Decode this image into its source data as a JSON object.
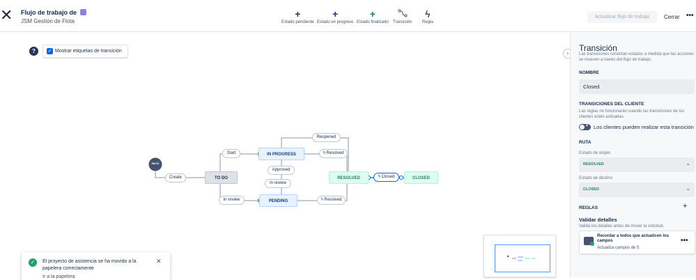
{
  "header": {
    "title": "Flujo de trabajo de",
    "project": "JSM Gestión de Flota",
    "toolbar": [
      {
        "label": "Estado pendiente",
        "icon": "plus-icon"
      },
      {
        "label": "Estado en progreso",
        "icon": "plus-icon"
      },
      {
        "label": "Estado finalizado",
        "icon": "plus-icon"
      },
      {
        "label": "Transición",
        "icon": "transition-icon"
      },
      {
        "label": "Regla",
        "icon": "bolt-icon"
      }
    ],
    "update_button": "Actualizar flujo de trabajo",
    "close_button": "Cerrar"
  },
  "canvas": {
    "show_labels": "Mostrar etiquetas de transición",
    "show_labels_checked": true,
    "nodes": {
      "start": "INICIO",
      "todo": "TO DO",
      "in_progress": "IN PROGRESS",
      "pending": "PENDING",
      "resolved": "RESOLVED",
      "closed": "CLOSED"
    },
    "transitions": {
      "create": "Create",
      "start": "Start",
      "in_review_bottom": "In review",
      "approved": "Approved",
      "in_review_mid": "In review",
      "reopened": "Reopened",
      "resolved_top": "Resolved",
      "resolved_bottom": "Resolved",
      "closed": "Closed"
    }
  },
  "toast": {
    "message": "El proyecto de asistencia se ha movido a la papelera correctamente",
    "more": "Ir a la papelera"
  },
  "panel": {
    "title": "Transición",
    "subtitle": "Las transiciones conectan estados a medida que las acciones se mueven a través del flujo de trabajo.",
    "name_label": "NOMBRE",
    "name_value": "Closed",
    "customer_label": "TRANSICIONES DEL CLIENTE",
    "customer_help": "Las reglas no funcionarán cuando las transiciones de los clientes estén activadas.",
    "customer_toggle": "Los clientes pueden realizar esta transición",
    "customer_toggle_on": false,
    "route_label": "RUTA",
    "origin_label": "Estado de origen",
    "origin_value": "RESOLVED",
    "dest_label": "Estado de destino",
    "dest_value": "CLOSED",
    "rules_label": "REGLAS",
    "validate_title": "Validar detalles",
    "validate_sub": "Valida los detalles antes de mover la solicitud.",
    "rule_title": "Recordar a todos que actualicen los campos",
    "rule_sub": "Actualiza campos de 5"
  },
  "colors": {
    "accent": "#0c66e4",
    "todo_bg": "#dfe1e6",
    "in_progress_bg": "#e9f2ff",
    "done_bg": "#dcfff1",
    "done_text": "#1f845a",
    "start_bg": "#44546f"
  }
}
